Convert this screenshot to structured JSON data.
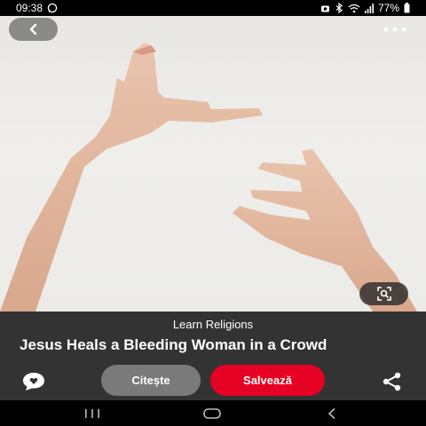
{
  "status_bar": {
    "time": "09:38",
    "battery": "77%",
    "left_icons": [
      "whatsapp-icon"
    ],
    "right_icons": [
      "camera-icon",
      "bluetooth-icon",
      "wifi-icon",
      "signal-icon",
      "battery-icon"
    ]
  },
  "pin": {
    "image_subject": "two-hands-reaching",
    "source": "Learn Religions",
    "title": "Jesus Heals a Bleeding Woman in a Crowd"
  },
  "actions": {
    "read_label": "Citește",
    "save_label": "Salvează"
  },
  "icons": {
    "back": "chevron-left-icon",
    "more": "more-horizontal-icon",
    "visual_search": "lens-icon",
    "comment": "comment-icon",
    "share": "share-icon"
  },
  "nav": [
    "recent-apps-icon",
    "home-icon",
    "back-icon"
  ],
  "colors": {
    "save_button": "#e60023",
    "read_button": "#7a7a7a",
    "panel": "#333333"
  }
}
